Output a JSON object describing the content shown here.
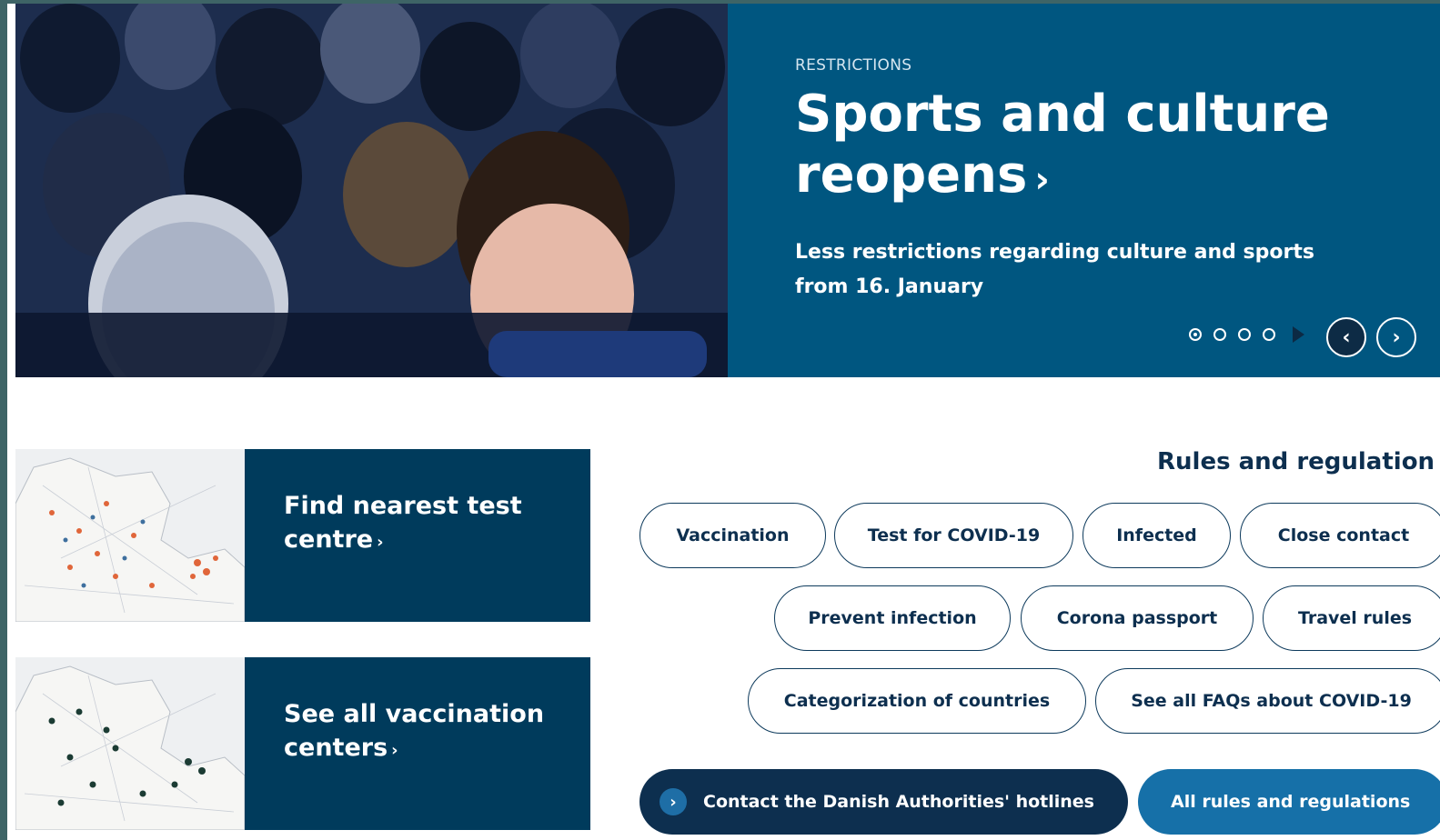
{
  "hero": {
    "eyebrow": "RESTRICTIONS",
    "title": "Sports and culture reopens",
    "title_chevron": "›",
    "subtitle": "Less restrictions regarding culture and sports from 16. January",
    "prev_icon": "‹",
    "next_icon": "›"
  },
  "cards": [
    {
      "label": "Find nearest test centre",
      "chevron": "›"
    },
    {
      "label": "See all vaccination centers",
      "chevron": "›"
    }
  ],
  "rules": {
    "title": "Rules and regulation",
    "pills": [
      "Vaccination",
      "Test for COVID-19",
      "Infected",
      "Close contact",
      "Prevent infection",
      "Corona passport",
      "Travel rules",
      "Categorization of countries",
      "See all FAQs about COVID-19"
    ],
    "contact_button": "Contact the Danish Authorities' hotlines",
    "contact_icon": "›",
    "all_rules_button": "All rules and regulations"
  },
  "colors": {
    "hero_panel": "#005680",
    "card_bg": "#003b5c",
    "dark_button": "#0d2f4f",
    "blue_button": "#1670a8"
  }
}
